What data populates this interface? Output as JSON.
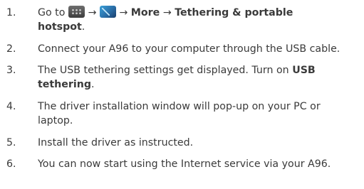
{
  "steps": [
    {
      "number": "1.",
      "go_to": "Go to",
      "arrow1": "→",
      "arrow2": "→",
      "more": "More",
      "arrow3": "→",
      "bold_line1": "Tethering & portable",
      "bold_line2": "hotspot",
      "period": ".",
      "icon1": "apps-icon",
      "icon2": "settings-icon"
    },
    {
      "number": "2.",
      "text": "Connect your A96 to your computer through the USB cable."
    },
    {
      "number": "3.",
      "text_before": "The USB tethering settings get displayed. Turn on",
      "bold1": "USB",
      "bold2": "tethering",
      "period": "."
    },
    {
      "number": "4.",
      "line1": "The driver installation window will pop-up on your PC or",
      "line2": "laptop."
    },
    {
      "number": "5.",
      "text": "Install the driver as instructed."
    },
    {
      "number": "6.",
      "text": "You can now start using the Internet service via your A96."
    }
  ]
}
